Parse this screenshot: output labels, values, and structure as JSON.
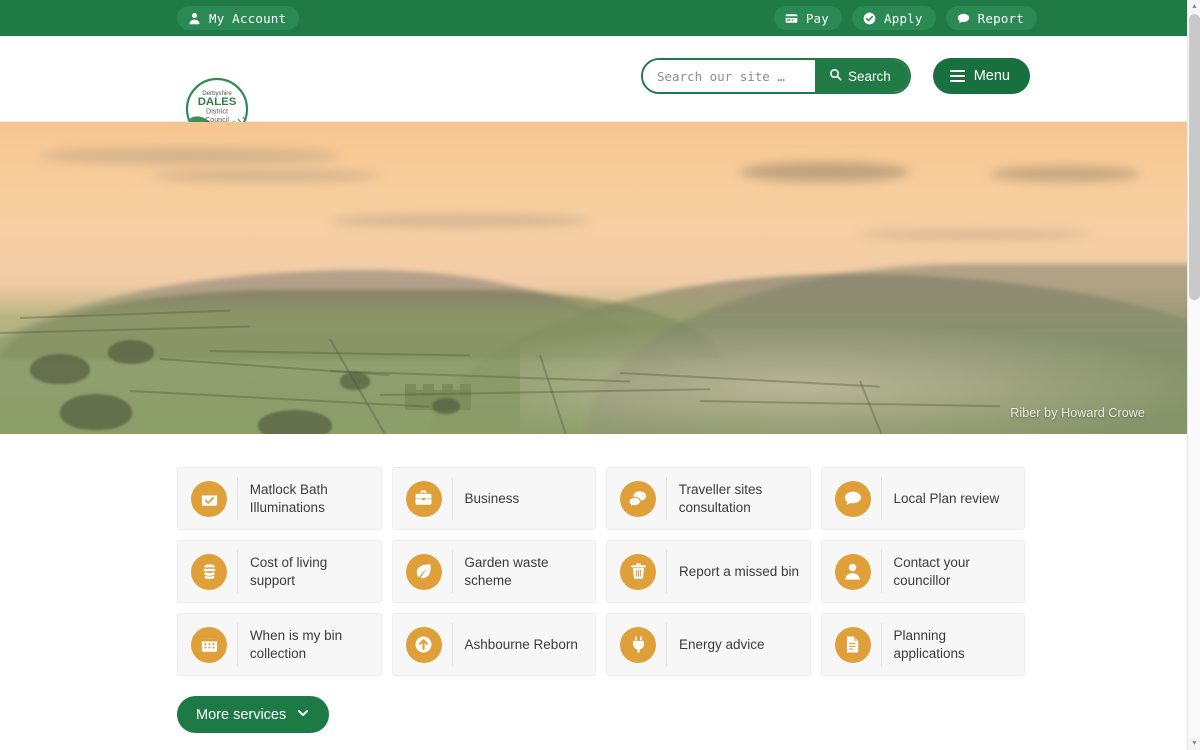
{
  "topbar": {
    "account": {
      "label": "My Account",
      "icon": "user-icon"
    },
    "actions": [
      {
        "label": "Pay",
        "icon": "card-icon"
      },
      {
        "label": "Apply",
        "icon": "check-circle-icon"
      },
      {
        "label": "Report",
        "icon": "chat-icon"
      }
    ]
  },
  "header": {
    "logo": {
      "line1": "Derbyshire",
      "line2": "DALES",
      "line3": "District",
      "line4": "Council",
      "name": "derbyshire-dales-district-council-logo"
    },
    "search": {
      "placeholder": "Search our site …",
      "value": "",
      "button_label": "Search",
      "icon": "search-icon"
    },
    "menu": {
      "label": "Menu",
      "icon": "hamburger-icon"
    }
  },
  "hero": {
    "credit": "Riber by Howard Crowe",
    "alt": "Misty sunset over Riber with castle silhouette"
  },
  "services": {
    "tiles": [
      {
        "label": "Matlock Bath Illuminations",
        "icon": "calendar-check-icon"
      },
      {
        "label": "Business",
        "icon": "briefcase-icon"
      },
      {
        "label": "Traveller sites consultation",
        "icon": "chat-double-icon"
      },
      {
        "label": "Local Plan review",
        "icon": "chat-icon"
      },
      {
        "label": "Cost of living support",
        "icon": "coins-icon"
      },
      {
        "label": "Garden waste scheme",
        "icon": "leaf-icon"
      },
      {
        "label": "Report a missed bin",
        "icon": "trash-icon"
      },
      {
        "label": "Contact your councillor",
        "icon": "user-icon"
      },
      {
        "label": "When is my bin collection",
        "icon": "calendar-icon"
      },
      {
        "label": "Ashbourne Reborn",
        "icon": "arrow-up-circle-icon"
      },
      {
        "label": "Energy advice",
        "icon": "plug-icon"
      },
      {
        "label": "Planning applications",
        "icon": "document-icon"
      }
    ],
    "more_button": {
      "label": "More services",
      "icon": "chevron-down-icon"
    }
  },
  "colors": {
    "brand_green": "#1f7a46",
    "brand_green_dark": "#17703d",
    "accent_orange": "#dfa03a",
    "tile_bg": "#f7f7f7",
    "text": "#3b3b3b"
  },
  "scrollbar": {
    "position": "right",
    "thumb_top_pct": 2,
    "thumb_height_pct": 38
  }
}
